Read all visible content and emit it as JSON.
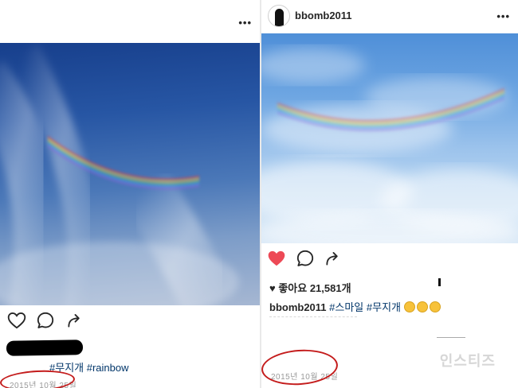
{
  "left_post": {
    "more_icon": "ellipsis-icon",
    "caption_hashtags": "#무지개 #rainbow",
    "timestamp": "2015년 10월 25일",
    "actions": [
      "heart-icon",
      "comment-icon",
      "share-icon"
    ]
  },
  "right_post": {
    "username": "bbomb2011",
    "more_icon": "ellipsis-icon",
    "likes_text": "♥ 좋아요 21,581개",
    "caption_user": "bbomb2011",
    "caption_hashtags": "#스마일 #무지개",
    "timestamp": "2015년 10월 25일",
    "actions": [
      "heart-filled-icon",
      "comment-icon",
      "share-icon"
    ]
  },
  "watermark": "인스티즈",
  "colors": {
    "like_red": "#ed4956",
    "annotation_red": "#c41c1c",
    "hashtag_blue": "#003569"
  }
}
